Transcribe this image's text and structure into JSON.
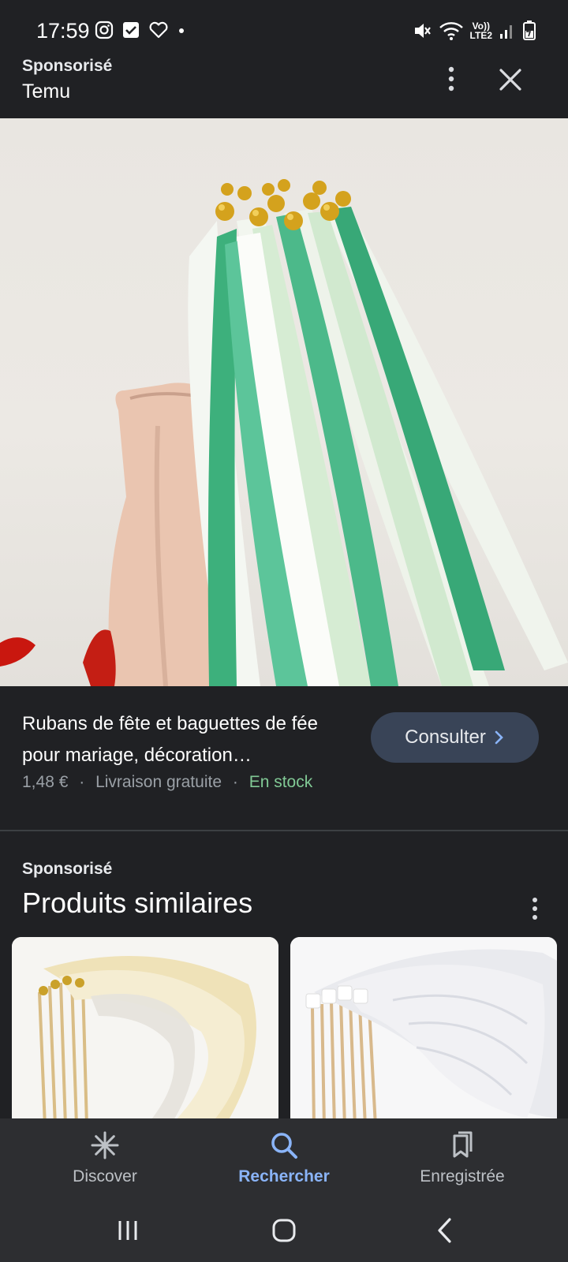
{
  "status_bar": {
    "time": "17:59",
    "left_icons": [
      "instagram-icon",
      "checkbox-icon",
      "heart-icon",
      "dot-icon"
    ],
    "right_icons": [
      "mute-icon",
      "wifi-icon",
      "volte-lte2-icon",
      "signal-icon",
      "battery-charging-icon"
    ],
    "network_label_top": "Vo))",
    "network_label_bottom": "LTE2"
  },
  "header": {
    "sponsor_label": "Sponsorisé",
    "advertiser": "Temu",
    "more_icon": "more-vert-icon",
    "close_icon": "close-icon"
  },
  "hero": {
    "image_subject": "satin ribbon wands in white and mint green with gold bells in a pink vase"
  },
  "product": {
    "title": "Rubans de fête et baguettes de fée pour mariage, décoration…",
    "price": "1,48 €",
    "separator": "·",
    "shipping": "Livraison gratuite",
    "stock": "En stock",
    "consult_label": "Consulter",
    "consult_icon": "chevron-right-icon"
  },
  "similar": {
    "sponsor_label": "Sponsorisé",
    "title": "Produits similaires",
    "more_icon": "more-vert-icon"
  },
  "bottom_nav": {
    "items": [
      {
        "label": "Discover",
        "icon": "asterisk-icon",
        "active": false
      },
      {
        "label": "Rechercher",
        "icon": "search-icon",
        "active": true
      },
      {
        "label": "Enregistrée",
        "icon": "saved-bookmarks-icon",
        "active": false
      }
    ]
  },
  "system_nav": [
    "recents-icon",
    "home-icon",
    "back-icon"
  ],
  "colors": {
    "background": "#202124",
    "accent": "#8ab4f8",
    "stock_green": "#81c995",
    "button_bg": "#394457",
    "nav_bg": "#2d2e31",
    "ribbon_green": "#4fb88a",
    "ribbon_light": "#d8ecd8"
  }
}
